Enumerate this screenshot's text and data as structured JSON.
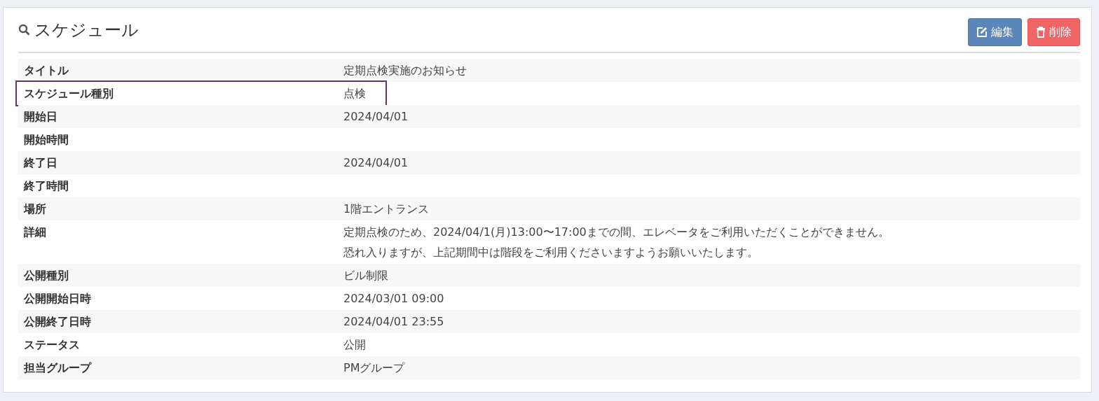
{
  "panel": {
    "title": "スケジュール",
    "buttons": [
      {
        "kind": "edit",
        "label": "編集"
      },
      {
        "kind": "delete",
        "label": "削除"
      }
    ]
  },
  "rows": [
    {
      "label": "タイトル",
      "value": "定期点検実施のお知らせ",
      "highlighted": false
    },
    {
      "label": "スケジュール種別",
      "value": "点検",
      "highlighted": true
    },
    {
      "label": "開始日",
      "value": "2024/04/01",
      "highlighted": false
    },
    {
      "label": "開始時間",
      "highlighted": false
    },
    {
      "label": "終了日",
      "value": "2024/04/01",
      "highlighted": false
    },
    {
      "label": "終了時間",
      "highlighted": false
    },
    {
      "label": "場所",
      "value": "1階エントランス",
      "highlighted": false
    },
    {
      "label": "詳細",
      "value_lines": [
        "定期点検のため、2024/04/1(月)13:00〜17:00までの間、エレベータをご利用いただくことができません。",
        "恐れ入りますが、上記期間中は階段をご利用くださいますようお願いいたします。"
      ],
      "highlighted": false
    },
    {
      "label": "公開種別",
      "value": "ビル制限",
      "highlighted": false
    },
    {
      "label": "公開開始日時",
      "value": "2024/03/01 09:00",
      "highlighted": false
    },
    {
      "label": "公開終了日時",
      "value": "2024/04/01 23:55",
      "highlighted": false
    },
    {
      "label": "ステータス",
      "value": "公開",
      "highlighted": false
    },
    {
      "label": "担当グループ",
      "value": "PMグループ",
      "highlighted": false
    }
  ]
}
